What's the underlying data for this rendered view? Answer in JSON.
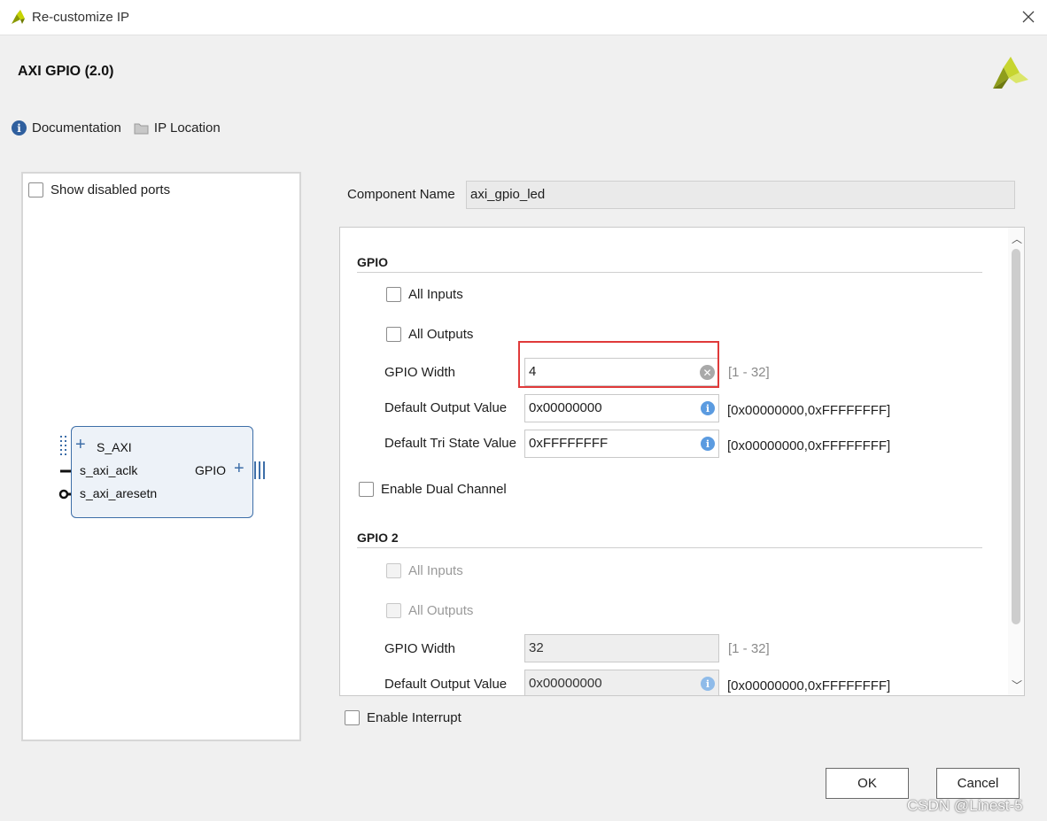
{
  "window": {
    "title": "Re-customize IP",
    "close_glyph": "✕"
  },
  "header": {
    "title": "AXI GPIO (2.0)",
    "links": [
      {
        "label": "Documentation",
        "icon": "info-icon"
      },
      {
        "label": "IP Location",
        "icon": "folder-icon"
      }
    ]
  },
  "left_panel": {
    "show_disabled_ports": {
      "label": "Show disabled ports",
      "checked": false
    },
    "block": {
      "ports_left": [
        "S_AXI",
        "s_axi_aclk",
        "s_axi_aresetn"
      ],
      "port_right": "GPIO"
    }
  },
  "component": {
    "label": "Component Name",
    "value": "axi_gpio_led"
  },
  "gpio": {
    "title": "GPIO",
    "all_inputs": {
      "label": "All Inputs",
      "checked": false
    },
    "all_outputs": {
      "label": "All Outputs",
      "checked": false
    },
    "width": {
      "label": "GPIO Width",
      "value": "4",
      "range": "[1 - 32]"
    },
    "default_output": {
      "label": "Default Output Value",
      "value": "0x00000000",
      "range": "[0x00000000,0xFFFFFFFF]"
    },
    "default_tri": {
      "label": "Default Tri State Value",
      "value": "0xFFFFFFFF",
      "range": "[0x00000000,0xFFFFFFFF]"
    },
    "dual_channel": {
      "label": "Enable Dual Channel",
      "checked": false
    }
  },
  "gpio2": {
    "title": "GPIO 2",
    "all_inputs": {
      "label": "All Inputs",
      "checked": false
    },
    "all_outputs": {
      "label": "All Outputs",
      "checked": false
    },
    "width": {
      "label": "GPIO Width",
      "value": "32",
      "range": "[1 - 32]"
    },
    "default_output": {
      "label": "Default Output Value",
      "value": "0x00000000",
      "range": "[0x00000000,0xFFFFFFFF]"
    }
  },
  "interrupt": {
    "label": "Enable Interrupt",
    "checked": false
  },
  "buttons": {
    "ok": "OK",
    "cancel": "Cancel"
  },
  "watermark": "CSDN @Linest-5",
  "colors": {
    "accent": "#2f5f9e",
    "highlight": "#e03a3a",
    "brand": "#a5b800"
  }
}
